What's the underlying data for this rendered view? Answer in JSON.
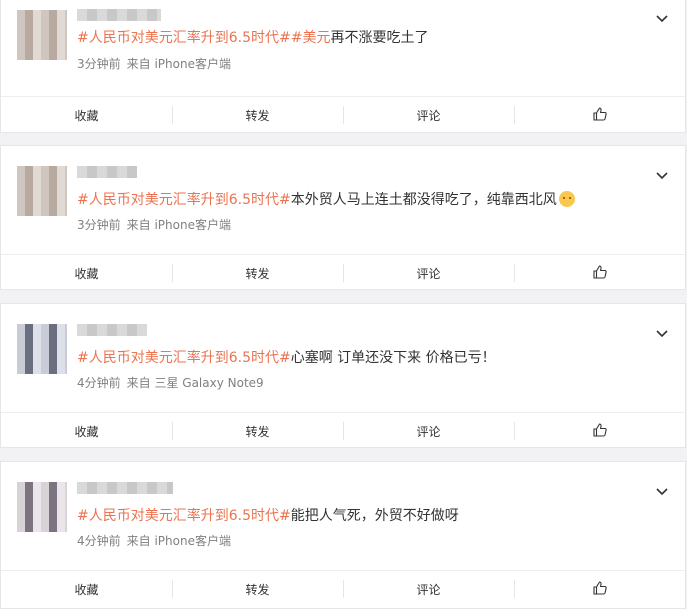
{
  "posts": [
    {
      "hashtag_topic": "#人民币对美元汇率升到6.5时代#",
      "hashtag_2": "#美元",
      "body": "再不涨要吃土了",
      "time": "3分钟前",
      "source": "来自 iPhone客户端"
    },
    {
      "hashtag_topic": "#人民币对美元汇率升到6.5时代#",
      "body": "本外贸人马上连土都没得吃了，纯靠西北风",
      "emoji": "face-emoji",
      "time": "3分钟前",
      "source": "来自 iPhone客户端"
    },
    {
      "hashtag_topic": "#人民币对美元汇率升到6.5时代#",
      "body": "心塞啊 订单还没下来 价格已亏！",
      "time": "4分钟前",
      "source": "来自 三星 Galaxy Note9"
    },
    {
      "hashtag_topic": "#人民币对美元汇率升到6.5时代#",
      "body": "能把人气死，外贸不好做呀",
      "time": "4分钟前",
      "source": "来自 iPhone客户端"
    }
  ],
  "actions": {
    "favorite": "收藏",
    "repost": "转发",
    "comment": "评论",
    "like_icon": "thumbs-up-icon"
  },
  "colors": {
    "topic": "#eb7350",
    "hash": "#3e73c2",
    "meta": "#808080"
  }
}
